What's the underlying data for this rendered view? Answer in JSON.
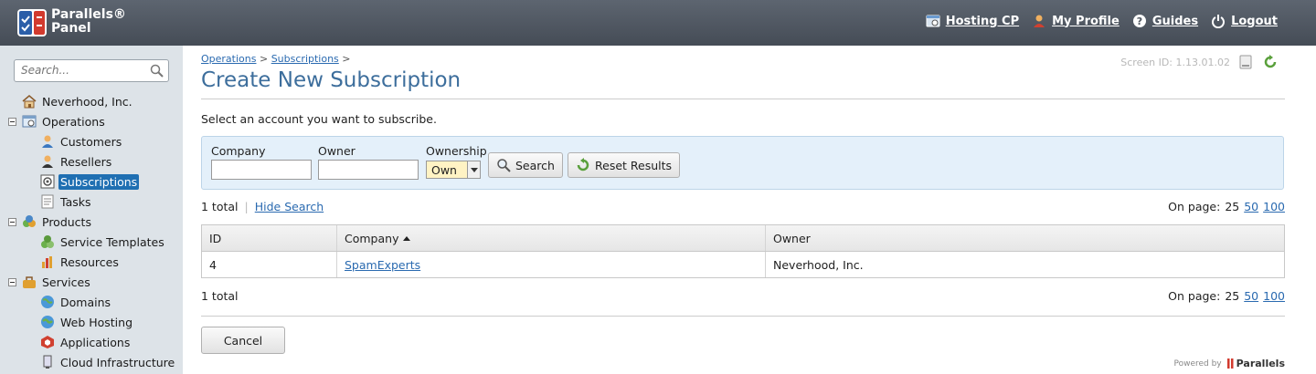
{
  "header": {
    "logo_line1": "Parallels®",
    "logo_line2": "Panel",
    "nav": [
      {
        "label": "Hosting CP",
        "icon": "hosting-cp-icon"
      },
      {
        "label": "My Profile",
        "icon": "user-icon"
      },
      {
        "label": "Guides",
        "icon": "help-icon"
      },
      {
        "label": "Logout",
        "icon": "power-icon"
      }
    ]
  },
  "sidebar": {
    "search_placeholder": "Search...",
    "tree": [
      {
        "label": "Neverhood, Inc.",
        "icon": "home-icon"
      },
      {
        "label": "Operations",
        "icon": "operations-icon"
      },
      {
        "label": "Customers",
        "icon": "customer-icon"
      },
      {
        "label": "Resellers",
        "icon": "reseller-icon"
      },
      {
        "label": "Subscriptions",
        "icon": "subscription-icon"
      },
      {
        "label": "Tasks",
        "icon": "tasks-icon"
      },
      {
        "label": "Products",
        "icon": "products-icon"
      },
      {
        "label": "Service Templates",
        "icon": "service-templates-icon"
      },
      {
        "label": "Resources",
        "icon": "resources-icon"
      },
      {
        "label": "Services",
        "icon": "services-icon"
      },
      {
        "label": "Domains",
        "icon": "domains-icon"
      },
      {
        "label": "Web Hosting",
        "icon": "web-hosting-icon"
      },
      {
        "label": "Applications",
        "icon": "applications-icon"
      },
      {
        "label": "Cloud Infrastructure",
        "icon": "cloud-icon"
      }
    ]
  },
  "main": {
    "breadcrumb": [
      "Operations",
      "Subscriptions"
    ],
    "breadcrumb_sep": ">",
    "title": "Create New Subscription",
    "screen_id": "Screen ID:  1.13.01.02",
    "hint": "Select an account you want to subscribe.",
    "filter": {
      "company_label": "Company",
      "owner_label": "Owner",
      "ownership_label": "Ownership",
      "company_value": "",
      "owner_value": "",
      "ownership_value": "Own",
      "search_label": "Search",
      "reset_label": "Reset Results"
    },
    "total_text": "1 total",
    "hide_search": "Hide Search",
    "on_page_label": "On page:",
    "page_sizes": [
      "25",
      "50",
      "100"
    ],
    "columns": [
      "ID",
      "Company",
      "Owner"
    ],
    "rows": [
      {
        "id": "4",
        "company": "SpamExperts",
        "owner": "Neverhood, Inc."
      }
    ],
    "cancel_label": "Cancel",
    "powered_by": "Powered by",
    "brand": "Parallels"
  },
  "colors": {
    "header_bg": "#4f5660",
    "sidebar_bg": "#dde3e8",
    "title": "#3d6e9c",
    "link": "#2a6ab0",
    "selected": "#1f6fb2",
    "filter_bg": "#e4f0fa"
  }
}
